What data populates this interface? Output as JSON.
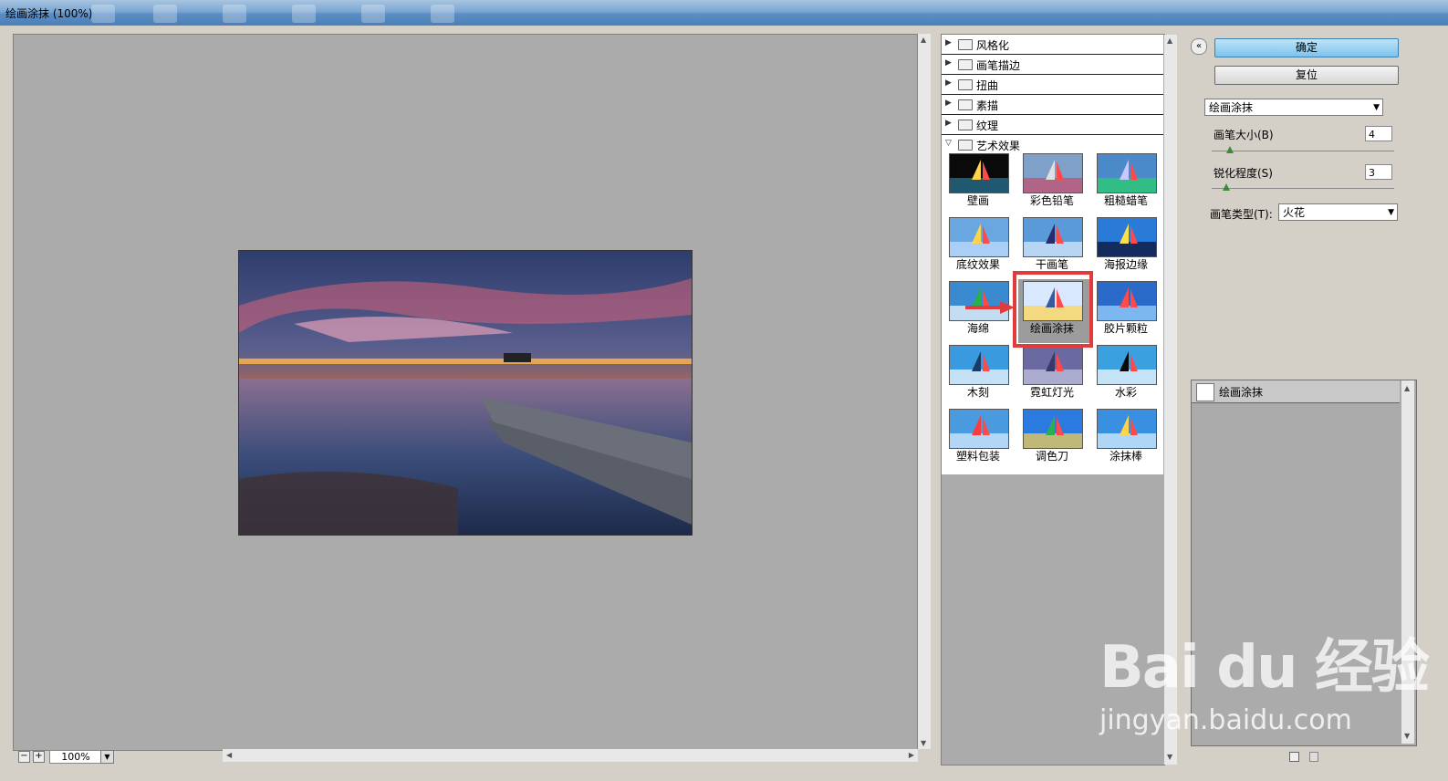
{
  "window": {
    "title": "绘画涂抹 (100%)"
  },
  "preview": {
    "zoom": "100%",
    "zoom_out": "−",
    "zoom_in": "+"
  },
  "filter_categories": [
    {
      "label": "风格化",
      "expanded": false
    },
    {
      "label": "画笔描边",
      "expanded": false
    },
    {
      "label": "扭曲",
      "expanded": false
    },
    {
      "label": "素描",
      "expanded": false
    },
    {
      "label": "纹理",
      "expanded": false
    },
    {
      "label": "艺术效果",
      "expanded": true
    }
  ],
  "art_filters": [
    {
      "label": "壁画"
    },
    {
      "label": "彩色铅笔"
    },
    {
      "label": "粗糙蜡笔"
    },
    {
      "label": "底纹效果"
    },
    {
      "label": "干画笔"
    },
    {
      "label": "海报边缘"
    },
    {
      "label": "海绵"
    },
    {
      "label": "绘画涂抹",
      "selected": true
    },
    {
      "label": "胶片颗粒"
    },
    {
      "label": "木刻"
    },
    {
      "label": "霓虹灯光"
    },
    {
      "label": "水彩"
    },
    {
      "label": "塑料包装"
    },
    {
      "label": "调色刀"
    },
    {
      "label": "涂抹棒"
    }
  ],
  "buttons": {
    "ok": "确定",
    "reset": "复位",
    "collapse": "«"
  },
  "settings": {
    "filter_select": "绘画涂抹",
    "brush_size": {
      "label": "画笔大小(B)",
      "value": "4",
      "fraction": 0.1
    },
    "sharpness": {
      "label": "锐化程度(S)",
      "value": "3",
      "fraction": 0.08
    },
    "brush_type": {
      "label": "画笔类型(T):",
      "value": "火花"
    }
  },
  "layers": {
    "item": "绘画涂抹"
  },
  "watermark": {
    "logo": "Bai du 经验",
    "url": "jingyan.baidu.com"
  },
  "colors": {
    "selection": "#e23b3b",
    "preview_bg": "#ababab",
    "ok_button": "#7cc3ec"
  }
}
